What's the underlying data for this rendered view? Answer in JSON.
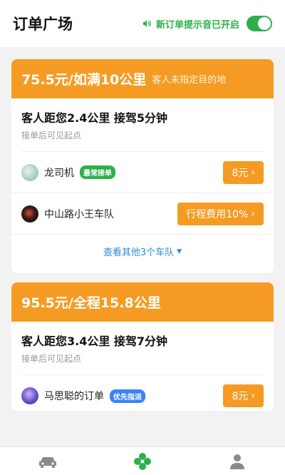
{
  "header": {
    "title": "订单广场",
    "sound_label": "新订单提示音已开启",
    "sound_enabled": true
  },
  "orders": [
    {
      "price": "75.5元/如满10公里",
      "price_note": "客人未指定目的地",
      "distance": "客人距您2.4公里  接驾5分钟",
      "hint": "接单后可见起点",
      "bidders": [
        {
          "name": "龙司机",
          "badge": "最常接单",
          "button": "8元"
        },
        {
          "name": "中山路小王车队",
          "badge": "",
          "button": "行程费用10%"
        }
      ],
      "more": "查看其他3个车队"
    },
    {
      "price": "95.5元/全程15.8公里",
      "distance": "客人距您3.4公里  接驾7分钟",
      "hint": "接单后可见起点",
      "bidders": [
        {
          "name": "马思聪的订单",
          "badge": "优先指派",
          "button": "8元"
        }
      ]
    }
  ],
  "colors": {
    "accent": "#f59b23",
    "green": "#2bb14a",
    "link": "#2a8ad6"
  },
  "tabbar": {
    "icons": [
      "car-icon",
      "clover-icon",
      "person-icon"
    ],
    "active": 1
  }
}
